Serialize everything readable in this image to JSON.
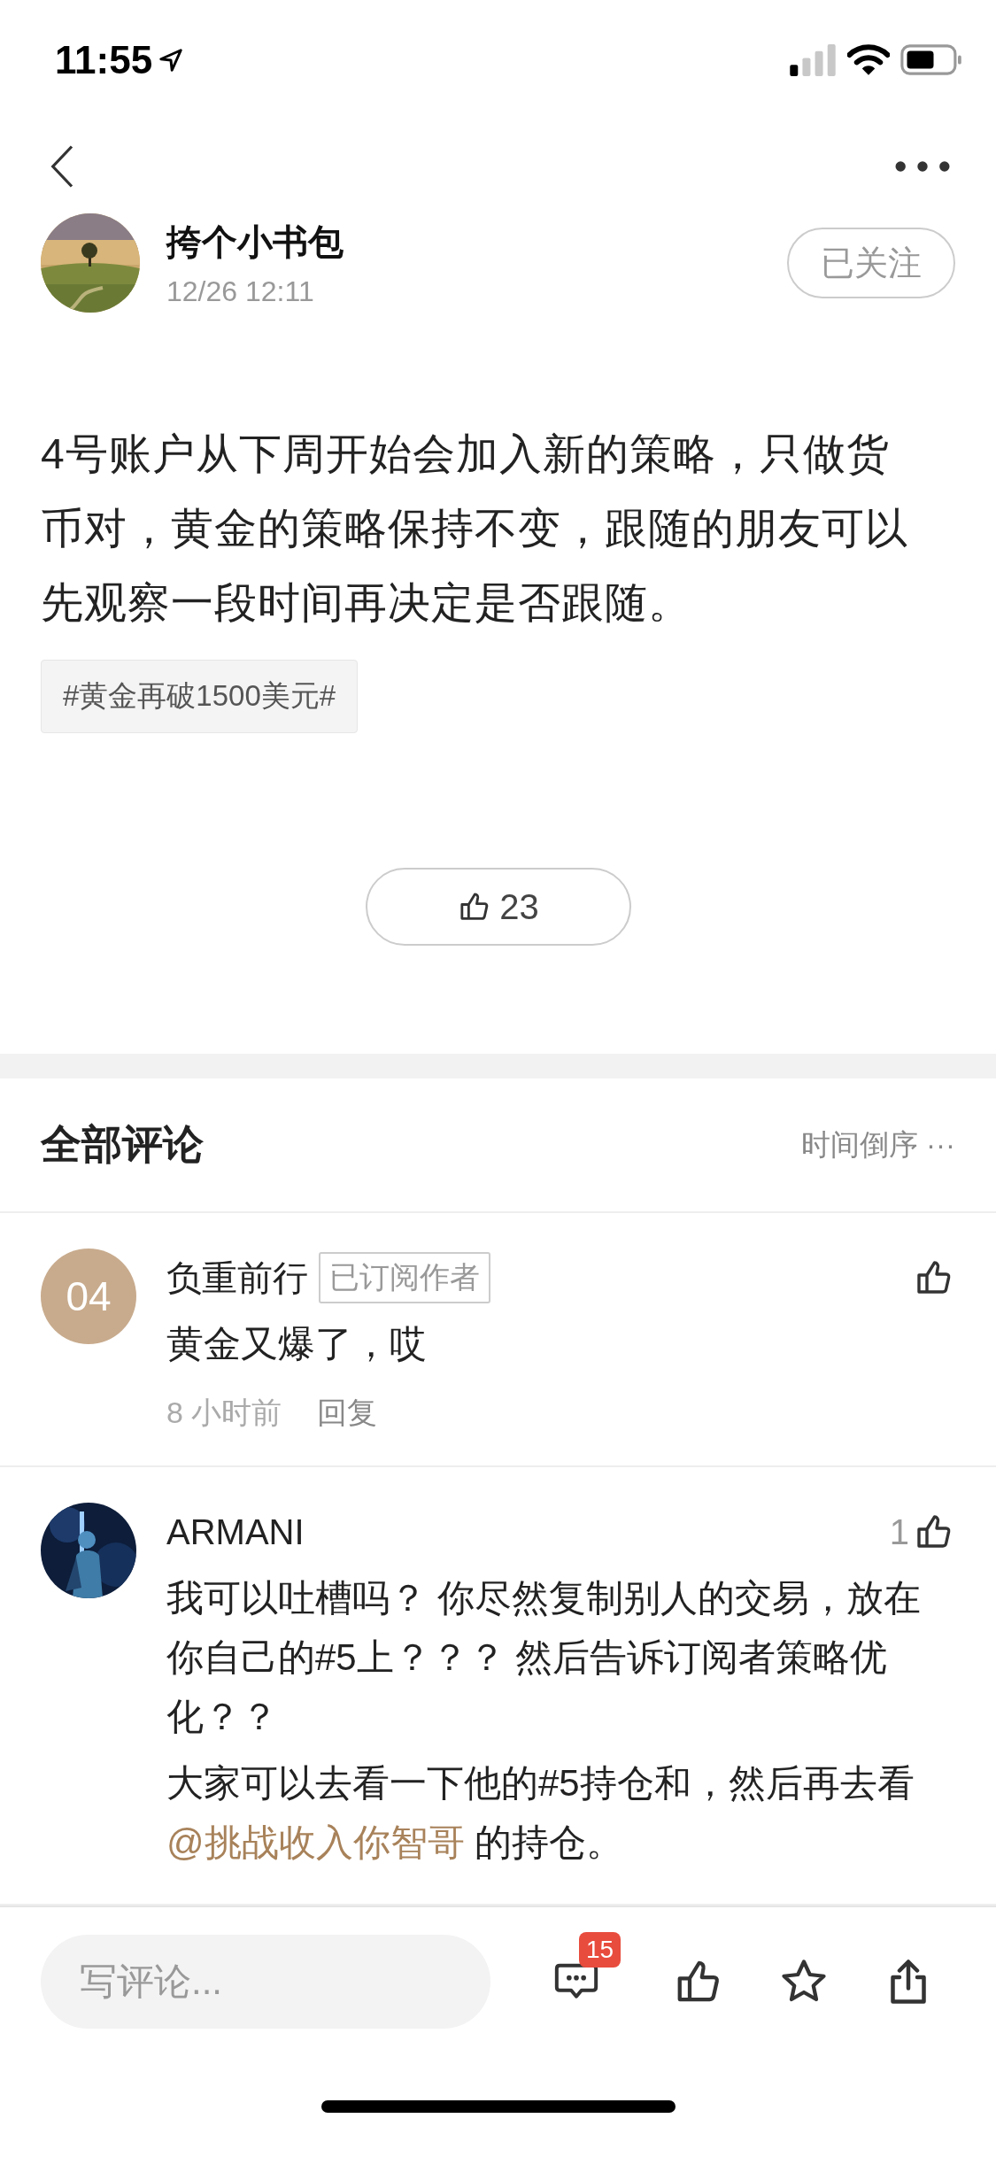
{
  "status_bar": {
    "time": "11:55"
  },
  "post": {
    "author": "挎个小书包",
    "date": "12/26 12:11",
    "follow_button": "已关注",
    "text": "4号账户从下周开始会加入新的策略，只做货币对，黄金的策略保持不变，跟随的朋友可以先观察一段时间再决定是否跟随。",
    "tags": [
      "#黄金再破1500美元#"
    ],
    "likes": "23"
  },
  "comments_header": {
    "title": "全部评论",
    "sort": "时间倒序",
    "more": "···"
  },
  "comments": [
    {
      "avatar": {
        "kind": "initials",
        "text": "04"
      },
      "name": "负重前行",
      "badge": "已订阅作者",
      "paragraphs": [
        {
          "text": "黄金又爆了，哎"
        }
      ],
      "time": "8 小时前",
      "reply": "回复"
    },
    {
      "name": "ARMANI",
      "like_count": "1",
      "paragraphs": [
        {
          "text": "我可以吐槽吗？ 你尽然复制别人的交易，放在你自己的#5上？？？ 然后告诉订阅者策略优化？？"
        },
        {
          "text": "大家可以去看一下他的#5持仓和，然后再去看",
          "mention": "@挑战收入你智哥",
          "after": " 的持仓。"
        }
      ]
    }
  ],
  "bottom_bar": {
    "placeholder": "写评论...",
    "comment_count": "15"
  }
}
